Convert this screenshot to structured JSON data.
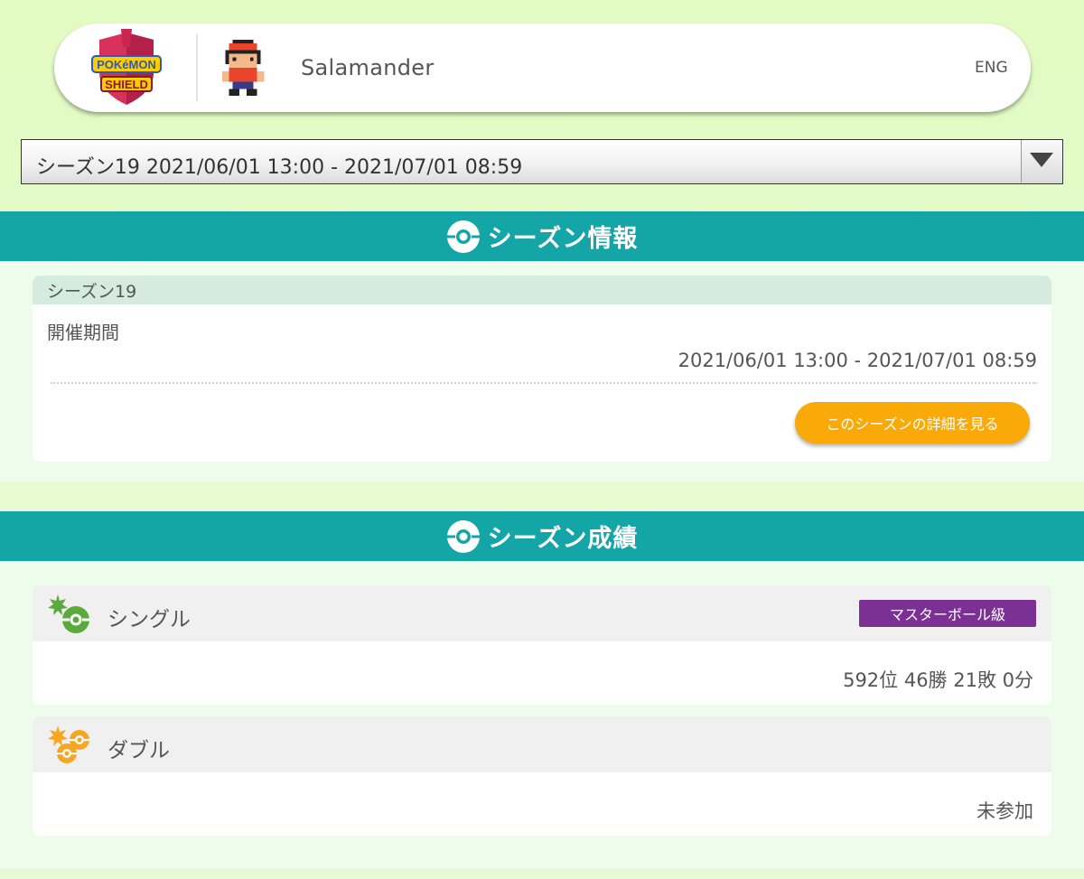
{
  "header": {
    "game_logo": "pokemon-shield-logo",
    "logo_lines": [
      "POKéMON",
      "SHIELD"
    ],
    "player_name": "Salamander",
    "language_toggle": "ENG"
  },
  "season_selector": {
    "selected": "シーズン19 2021/06/01 13:00 - 2021/07/01 08:59"
  },
  "season_info": {
    "section_title": "シーズン情報",
    "card_title": "シーズン19",
    "period_label": "開催期間",
    "period_value": "2021/06/01 13:00 - 2021/07/01 08:59",
    "detail_button": "このシーズンの詳細を見る"
  },
  "season_results": {
    "section_title": "シーズン成績",
    "single": {
      "title": "シングル",
      "rank_class": "マスターボール級",
      "result": "592位 46勝 21敗 0分"
    },
    "double": {
      "title": "ダブル",
      "result": "未参加"
    }
  },
  "colors": {
    "teal_band": "#14a6a6",
    "orange_button": "#f9aa08",
    "master_ball_badge": "#7a3193",
    "single_icon": "#5aaa3c",
    "double_icon": "#f6a623",
    "background": "#e1fbc1"
  }
}
